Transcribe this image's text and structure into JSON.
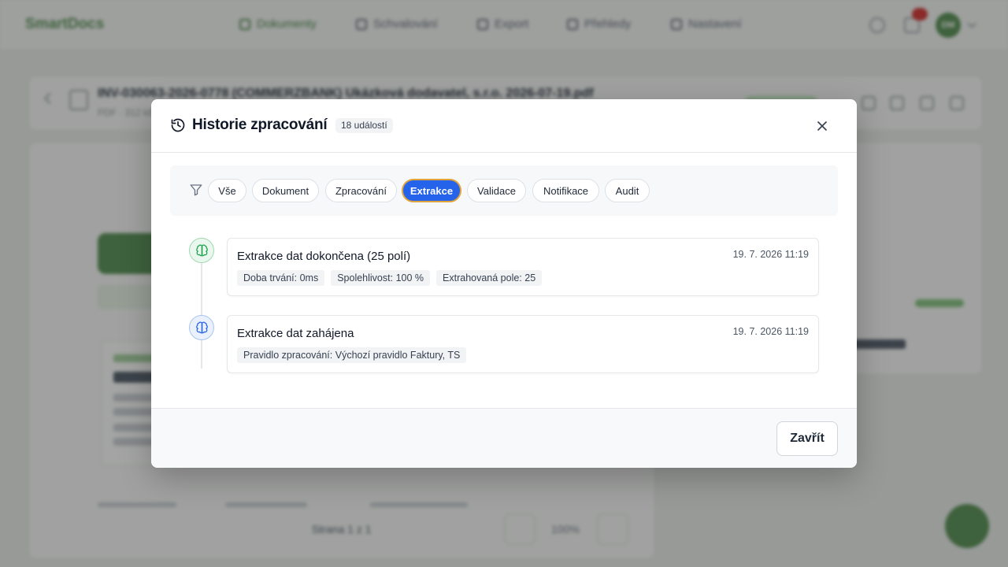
{
  "background": {
    "brand": "SmartDocs",
    "nav": [
      {
        "label": "Dokumenty",
        "icon": "document-icon",
        "active": true
      },
      {
        "label": "Schvalování",
        "icon": "approval-icon",
        "active": false
      },
      {
        "label": "Export",
        "icon": "export-icon",
        "active": false
      },
      {
        "label": "Přehledy",
        "icon": "reports-icon",
        "active": false
      },
      {
        "label": "Nastavení",
        "icon": "settings-icon",
        "active": false
      }
    ],
    "avatar_initials": "DM",
    "document_title": "INV-030063-2026-0778 (COMMERZBANK) Ukázková dodavatel, s.r.o. 2026-07-19.pdf",
    "document_subtitle": "PDF · 312 kB",
    "pager_label": "Strana 1 z 1",
    "zoom_label": "100%"
  },
  "modal": {
    "title": "Historie zpracování",
    "title_icon": "history-icon",
    "event_count": "18 událostí",
    "close_icon": "close-icon",
    "filter_icon": "funnel-icon",
    "filters": [
      {
        "label": "Vše",
        "active": false
      },
      {
        "label": "Dokument",
        "active": false
      },
      {
        "label": "Zpracování",
        "active": false
      },
      {
        "label": "Extrakce",
        "active": true
      },
      {
        "label": "Validace",
        "active": false
      },
      {
        "label": "Notifikace",
        "active": false
      },
      {
        "label": "Audit",
        "active": false
      }
    ],
    "events": [
      {
        "icon": "brain-icon",
        "status": "success",
        "title": "Extrakce dat dokončena (25 polí)",
        "time": "19. 7. 2026 11:19",
        "tags": [
          {
            "key": "Doba trvání:",
            "value": "0ms"
          },
          {
            "key": "Spolehlivost:",
            "value": "100 %"
          },
          {
            "key": "Extrahovaná pole:",
            "value": "25"
          }
        ]
      },
      {
        "icon": "brain-icon",
        "status": "info",
        "title": "Extrakce dat zahájena",
        "time": "19. 7. 2026 11:19",
        "tags": [
          {
            "key": "Pravidlo zpracování:",
            "value": "Výchozí pravidlo Faktury, TS"
          }
        ]
      }
    ],
    "close_button": "Zavřít"
  },
  "colors": {
    "accent_blue": "#2563eb",
    "active_chip_outline": "#e1a43a",
    "brand_green": "#4f8a4c"
  }
}
